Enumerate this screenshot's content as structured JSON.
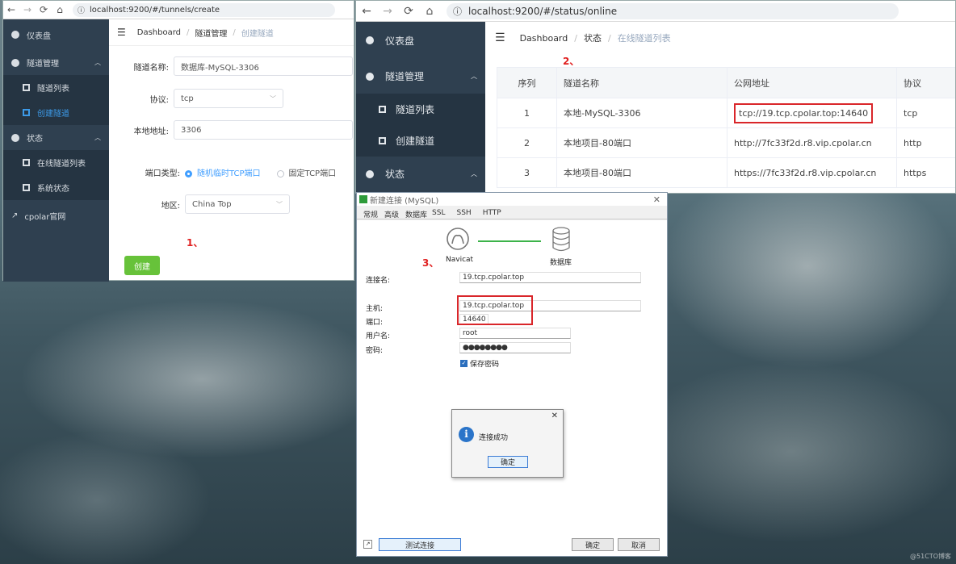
{
  "left_window": {
    "url": "localhost:9200/#/tunnels/create",
    "sidebar": [
      {
        "label": "仪表盘"
      },
      {
        "label": "隧道管理"
      },
      {
        "label": "隧道列表"
      },
      {
        "label": "创建隧道"
      },
      {
        "label": "状态"
      },
      {
        "label": "在线隧道列表"
      },
      {
        "label": "系统状态"
      },
      {
        "label": "cpolar官网"
      }
    ],
    "breadcrumb": [
      "Dashboard",
      "隧道管理",
      "创建隧道"
    ],
    "form": {
      "name_label": "隧道名称:",
      "name_value": "数据库-MySQL-3306",
      "protocol_label": "协议:",
      "protocol_value": "tcp",
      "local_label": "本地地址:",
      "local_value": "3306",
      "port_type_label": "端口类型:",
      "port_type_option1": "随机临时TCP端口",
      "port_type_option2": "固定TCP端口",
      "region_label": "地区:",
      "region_value": "China Top",
      "create_button": "创建"
    },
    "step_label": "1、"
  },
  "right_window": {
    "url": "localhost:9200/#/status/online",
    "sidebar": [
      {
        "label": "仪表盘"
      },
      {
        "label": "隧道管理"
      },
      {
        "label": "隧道列表"
      },
      {
        "label": "创建隧道"
      },
      {
        "label": "状态"
      }
    ],
    "breadcrumb": [
      "Dashboard",
      "状态",
      "在线隧道列表"
    ],
    "step_label": "2、",
    "table": {
      "headers": [
        "序列",
        "隧道名称",
        "公网地址",
        "协议"
      ],
      "rows": [
        [
          "1",
          "本地-MySQL-3306",
          "tcp://19.tcp.cpolar.top:14640",
          "tcp"
        ],
        [
          "2",
          "本地项目-80端口",
          "http://7fc33f2d.r8.vip.cpolar.cn",
          "http"
        ],
        [
          "3",
          "本地项目-80端口",
          "https://7fc33f2d.r8.vip.cpolar.cn",
          "https"
        ]
      ]
    }
  },
  "navicat_dialog": {
    "title": "新建连接 (MySQL)",
    "tabs": [
      "常规",
      "高级",
      "数据库",
      "SSL",
      "SSH",
      "HTTP"
    ],
    "navicat_label": "Navicat",
    "db_label": "数据库",
    "step_label": "3、",
    "connection_name_label": "连接名:",
    "connection_name_value": "19.tcp.cpolar.top",
    "host_label": "主机:",
    "host_value": "19.tcp.cpolar.top",
    "port_label": "端口:",
    "port_value": "14640",
    "user_label": "用户名:",
    "user_value": "root",
    "password_label": "密码:",
    "password_value": "●●●●●●●●",
    "save_password_label": "保存密码",
    "test_button": "测试连接",
    "ok_button": "确定",
    "cancel_button": "取消",
    "message": {
      "text": "连接成功",
      "ok_button": "确定"
    }
  },
  "watermark": "@51CTO博客"
}
